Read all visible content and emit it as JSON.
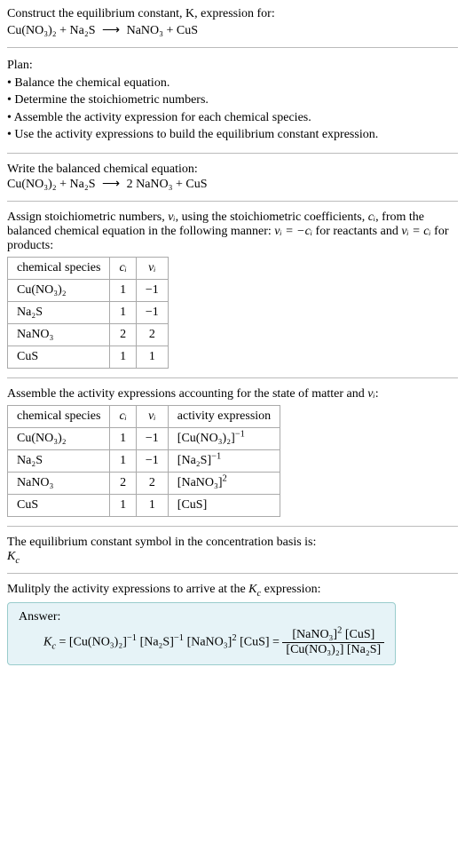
{
  "prompt": {
    "line1": "Construct the equilibrium constant, K, expression for:",
    "reaction_lhs": "Cu(NO₃)₂ + Na₂S",
    "arrow": "⟶",
    "reaction_rhs": "NaNO₃ + CuS"
  },
  "plan": {
    "title": "Plan:",
    "items": [
      "• Balance the chemical equation.",
      "• Determine the stoichiometric numbers.",
      "• Assemble the activity expression for each chemical species.",
      "• Use the activity expressions to build the equilibrium constant expression."
    ]
  },
  "balanced": {
    "title": "Write the balanced chemical equation:",
    "lhs": "Cu(NO₃)₂ + Na₂S",
    "arrow": "⟶",
    "rhs": "2 NaNO₃ + CuS"
  },
  "stoich": {
    "intro_a": "Assign stoichiometric numbers, ",
    "nu_i": "νᵢ",
    "intro_b": ", using the stoichiometric coefficients, ",
    "c_i": "cᵢ",
    "intro_c": ", from the balanced chemical equation in the following manner: ",
    "rule1": "νᵢ = −cᵢ",
    "intro_d": " for reactants and ",
    "rule2": "νᵢ = cᵢ",
    "intro_e": " for products:",
    "headers": [
      "chemical species",
      "cᵢ",
      "νᵢ"
    ],
    "rows": [
      [
        "Cu(NO₃)₂",
        "1",
        "−1"
      ],
      [
        "Na₂S",
        "1",
        "−1"
      ],
      [
        "NaNO₃",
        "2",
        "2"
      ],
      [
        "CuS",
        "1",
        "1"
      ]
    ]
  },
  "activity": {
    "intro_a": "Assemble the activity expressions accounting for the state of matter and ",
    "nu_i": "νᵢ",
    "intro_b": ":",
    "headers": [
      "chemical species",
      "cᵢ",
      "νᵢ",
      "activity expression"
    ],
    "rows": [
      {
        "species": "Cu(NO₃)₂",
        "c": "1",
        "nu": "−1",
        "expr_base": "[Cu(NO₃)₂]",
        "expr_sup": "−1"
      },
      {
        "species": "Na₂S",
        "c": "1",
        "nu": "−1",
        "expr_base": "[Na₂S]",
        "expr_sup": "−1"
      },
      {
        "species": "NaNO₃",
        "c": "2",
        "nu": "2",
        "expr_base": "[NaNO₃]",
        "expr_sup": "2"
      },
      {
        "species": "CuS",
        "c": "1",
        "nu": "1",
        "expr_base": "[CuS]",
        "expr_sup": ""
      }
    ]
  },
  "symbol": {
    "line1": "The equilibrium constant symbol in the concentration basis is:",
    "kc_base": "K",
    "kc_sub": "c"
  },
  "multiply": {
    "intro_a": "Mulitply the activity expressions to arrive at the ",
    "kc_base": "K",
    "kc_sub": "c",
    "intro_b": " expression:"
  },
  "answer": {
    "label": "Answer:",
    "kc_base": "K",
    "kc_sub": "c",
    "eq": " = ",
    "t1_base": "[Cu(NO₃)₂]",
    "t1_sup": "−1",
    "t2_base": "[Na₂S]",
    "t2_sup": "−1",
    "t3_base": "[NaNO₃]",
    "t3_sup": "2",
    "t4_base": "[CuS]",
    "eq2": " = ",
    "num_a_base": "[NaNO₃]",
    "num_a_sup": "2",
    "num_b": "[CuS]",
    "den_a": "[Cu(NO₃)₂]",
    "den_b": "[Na₂S]"
  },
  "chart_data": {
    "type": "table",
    "tables": [
      {
        "title": "Stoichiometric numbers",
        "columns": [
          "chemical species",
          "c_i",
          "nu_i"
        ],
        "rows": [
          [
            "Cu(NO3)2",
            1,
            -1
          ],
          [
            "Na2S",
            1,
            -1
          ],
          [
            "NaNO3",
            2,
            2
          ],
          [
            "CuS",
            1,
            1
          ]
        ]
      },
      {
        "title": "Activity expressions",
        "columns": [
          "chemical species",
          "c_i",
          "nu_i",
          "activity expression"
        ],
        "rows": [
          [
            "Cu(NO3)2",
            1,
            -1,
            "[Cu(NO3)2]^-1"
          ],
          [
            "Na2S",
            1,
            -1,
            "[Na2S]^-1"
          ],
          [
            "NaNO3",
            2,
            2,
            "[NaNO3]^2"
          ],
          [
            "CuS",
            1,
            1,
            "[CuS]"
          ]
        ]
      }
    ],
    "equilibrium_constant": "K_c = [NaNO3]^2 [CuS] / ([Cu(NO3)2] [Na2S])"
  }
}
